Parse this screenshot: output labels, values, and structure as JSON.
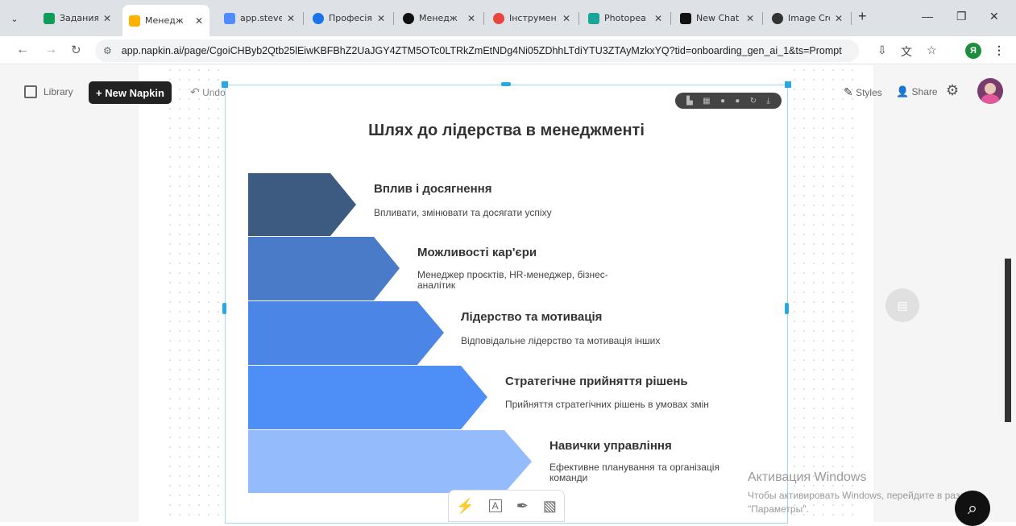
{
  "browser": {
    "tabs": [
      {
        "title": "Задания",
        "favicon_color": "#0f9d58",
        "active": false
      },
      {
        "title": "Менедж",
        "favicon_color": "#ffb300",
        "active": true
      },
      {
        "title": "app.steve",
        "favicon_color": "#4f8cff",
        "active": false
      },
      {
        "title": "Професія",
        "favicon_color": "#1a73e8",
        "active": false
      },
      {
        "title": "Менедж",
        "favicon_color": "#111111",
        "active": false
      },
      {
        "title": "Інструмен",
        "favicon_color": "#e8453c",
        "active": false
      },
      {
        "title": "Photopea",
        "favicon_color": "#18a497",
        "active": false
      },
      {
        "title": "New Chat",
        "favicon_color": "#111111",
        "active": false
      },
      {
        "title": "Image Cre",
        "favicon_color": "#333333",
        "active": false
      }
    ],
    "close_glyph": "✕",
    "new_tab": "+",
    "window_controls": {
      "minimize": "—",
      "restore": "❐",
      "close": "✕"
    },
    "url": "app.napkin.ai/page/CgoiCHByb2Qtb25lEiwKBFBhZ2UaJGY4ZTM5OTc0LTRkZmEtNDg4Ni05ZDhhLTdiYTU3ZTAyMzkxYQ?tid=onboarding_gen_ai_1&ts=Prompt",
    "profile_letter": "Я"
  },
  "app": {
    "library_label": "Library",
    "new_napkin_label": "+ New Napkin",
    "undo_label": "Undo",
    "styles_label": "Styles",
    "share_label": "Share"
  },
  "visual": {
    "title": "Шлях до лідерства в менеджменті",
    "steps": [
      {
        "title": "Вплив і досягнення",
        "desc": "Впливати, змінювати та досягати успіху",
        "color": "#3d5a80"
      },
      {
        "title": "Можливості кар'єри",
        "desc": "Менеджер проєктів, HR-менеджер, бізнес-аналітик",
        "color": "#4a7bc8"
      },
      {
        "title": "Лідерство та мотивація",
        "desc": "Відповідальне лідерство та мотивація інших",
        "color": "#4b86e6"
      },
      {
        "title": "Стратегічне прийняття рішень",
        "desc": "Прийняття стратегічних рішень в умовах змін",
        "color": "#4e8ff7"
      },
      {
        "title": "Навички управління",
        "desc": "Ефективне планування та організація команди",
        "color": "#94bbfb"
      }
    ]
  },
  "windows_activation": {
    "line1": "Активация Windows",
    "line2": "Чтобы активировать Windows, перейдите в раздел \"Параметры\"."
  }
}
